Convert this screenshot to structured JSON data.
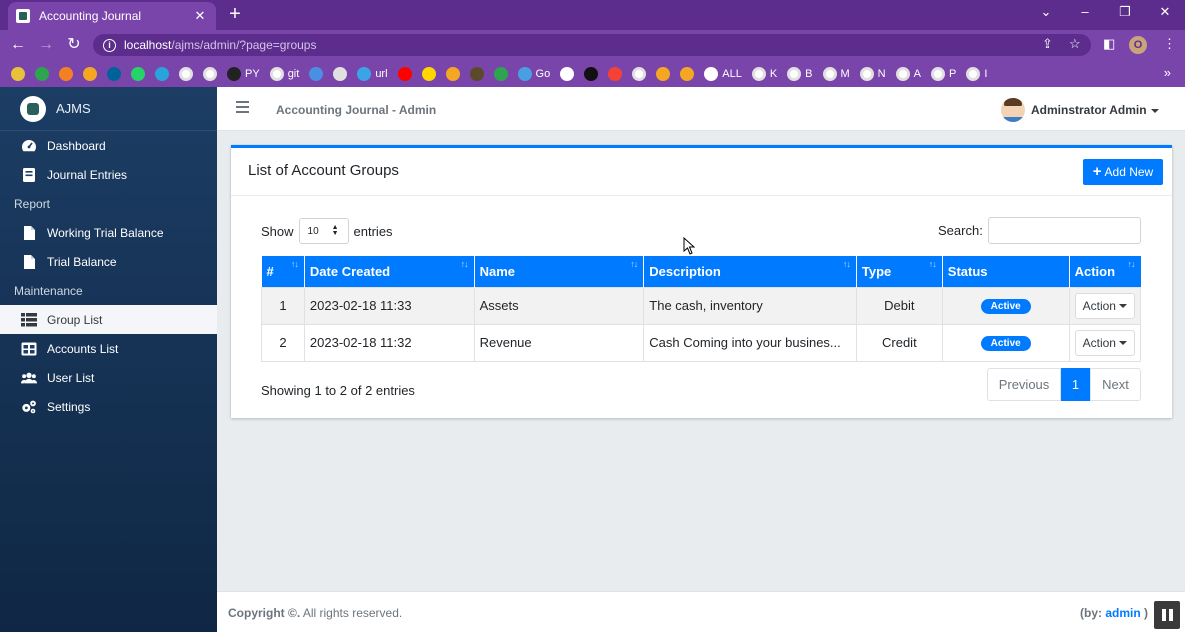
{
  "browser": {
    "tab_title": "Accounting Journal",
    "tab_close": "✕",
    "new_tab": "+",
    "url_host": "localhost",
    "url_path": "/ajms/admin/?page=groups",
    "profile_initial": "O",
    "bookmarks": [
      {
        "icon": "ln-icon",
        "label": "",
        "color": "#e8c23a"
      },
      {
        "icon": "plus-icon",
        "label": "",
        "color": "#2ea44f"
      },
      {
        "icon": "stack-icon",
        "label": "",
        "color": "#f48024"
      },
      {
        "icon": "chart-icon",
        "label": "",
        "color": "#f5a623"
      },
      {
        "icon": "ieee-icon",
        "label": "",
        "color": "#00629b"
      },
      {
        "icon": "whatsapp-icon",
        "label": "",
        "color": "#25d366"
      },
      {
        "icon": "telegram-icon",
        "label": "",
        "color": "#2aa3dc"
      },
      {
        "icon": "google-icon",
        "label": "",
        "color": "#ffffff"
      },
      {
        "icon": "google-icon",
        "label": "",
        "color": "#ffffff"
      },
      {
        "icon": "github-icon",
        "label": "PY",
        "color": "#222222"
      },
      {
        "icon": "google-icon",
        "label": "git",
        "color": "#ffffff"
      },
      {
        "icon": "image-icon",
        "label": "",
        "color": "#4a90e2"
      },
      {
        "icon": "store-icon",
        "label": "",
        "color": "#e0e0e0"
      },
      {
        "icon": "edge-icon",
        "label": "url",
        "color": "#3ba4e6"
      },
      {
        "icon": "youtube-icon",
        "label": "",
        "color": "#ff0000"
      },
      {
        "icon": "p-icon",
        "label": "",
        "color": "#ffd600"
      },
      {
        "icon": "film-icon",
        "label": "",
        "color": "#f5a623"
      },
      {
        "icon": "lion-icon",
        "label": "",
        "color": "#5a4a2a"
      },
      {
        "icon": "ring-icon",
        "label": "",
        "color": "#2ea44f"
      },
      {
        "icon": "go-icon",
        "label": "Go",
        "color": "#4a9fe0"
      },
      {
        "icon": "arrow-icon",
        "label": "",
        "color": "#ffffff"
      },
      {
        "icon": "cl-icon",
        "label": "",
        "color": "#111111"
      },
      {
        "icon": "ya-icon",
        "label": "",
        "color": "#f44336"
      },
      {
        "icon": "google-icon",
        "label": "",
        "color": "#ffffff"
      },
      {
        "icon": "flame-icon",
        "label": "",
        "color": "#f5a623"
      },
      {
        "icon": "eye-icon",
        "label": "",
        "color": "#f5a623"
      },
      {
        "icon": "globe-icon",
        "label": "ALL",
        "color": "#ffffff"
      },
      {
        "icon": "google-icon",
        "label": "K",
        "color": "#ffffff"
      },
      {
        "icon": "google-icon",
        "label": "B",
        "color": "#ffffff"
      },
      {
        "icon": "google-icon",
        "label": "M",
        "color": "#ffffff"
      },
      {
        "icon": "google-icon",
        "label": "N",
        "color": "#ffffff"
      },
      {
        "icon": "google-icon",
        "label": "A",
        "color": "#ffffff"
      },
      {
        "icon": "google-icon",
        "label": "P",
        "color": "#ffffff"
      },
      {
        "icon": "google-icon",
        "label": "I",
        "color": "#ffffff"
      }
    ],
    "bookmarks_more": "»",
    "colors": {
      "tabbar": "#5c2d8c",
      "toolbar": "#7a45ab"
    }
  },
  "sidebar": {
    "brand": "AJMS",
    "items": [
      {
        "label": "Dashboard",
        "icon": "dashboard-icon"
      },
      {
        "label": "Journal Entries",
        "icon": "journal-icon"
      }
    ],
    "report_header": "Report",
    "report_items": [
      {
        "label": "Working Trial Balance",
        "icon": "file-icon"
      },
      {
        "label": "Trial Balance",
        "icon": "file-icon"
      }
    ],
    "maintenance_header": "Maintenance",
    "maintenance_items": [
      {
        "label": "Group List",
        "icon": "list-icon",
        "active": true
      },
      {
        "label": "Accounts List",
        "icon": "table-icon"
      },
      {
        "label": "User List",
        "icon": "users-icon"
      },
      {
        "label": "Settings",
        "icon": "cogs-icon"
      }
    ]
  },
  "header": {
    "title": "Accounting Journal - Admin",
    "user": "Adminstrator Admin"
  },
  "card": {
    "title": "List of Account Groups",
    "add_button": "Add New",
    "show_label": "Show",
    "entries_label": "entries",
    "page_length": "10",
    "search_label": "Search:",
    "search_value": "",
    "columns": [
      "#",
      "Date Created",
      "Name",
      "Description",
      "Type",
      "Status",
      "Action"
    ],
    "rows": [
      {
        "num": "1",
        "date": "2023-02-18 11:33",
        "name": "Assets",
        "description": "The cash, inventory",
        "type": "Debit",
        "status": "Active",
        "action": "Action"
      },
      {
        "num": "2",
        "date": "2023-02-18 11:32",
        "name": "Revenue",
        "description": "Cash Coming into your busines...",
        "type": "Credit",
        "status": "Active",
        "action": "Action"
      }
    ],
    "info": "Showing 1 to 2 of 2 entries",
    "pagination": {
      "previous": "Previous",
      "current": "1",
      "next": "Next"
    },
    "accent": "#007bff"
  },
  "footer": {
    "copyright_bold": "Copyright ©.",
    "copyright_rest": " All rights reserved.",
    "by_prefix": "(by: ",
    "by_link": "admin",
    "by_suffix": " )"
  }
}
